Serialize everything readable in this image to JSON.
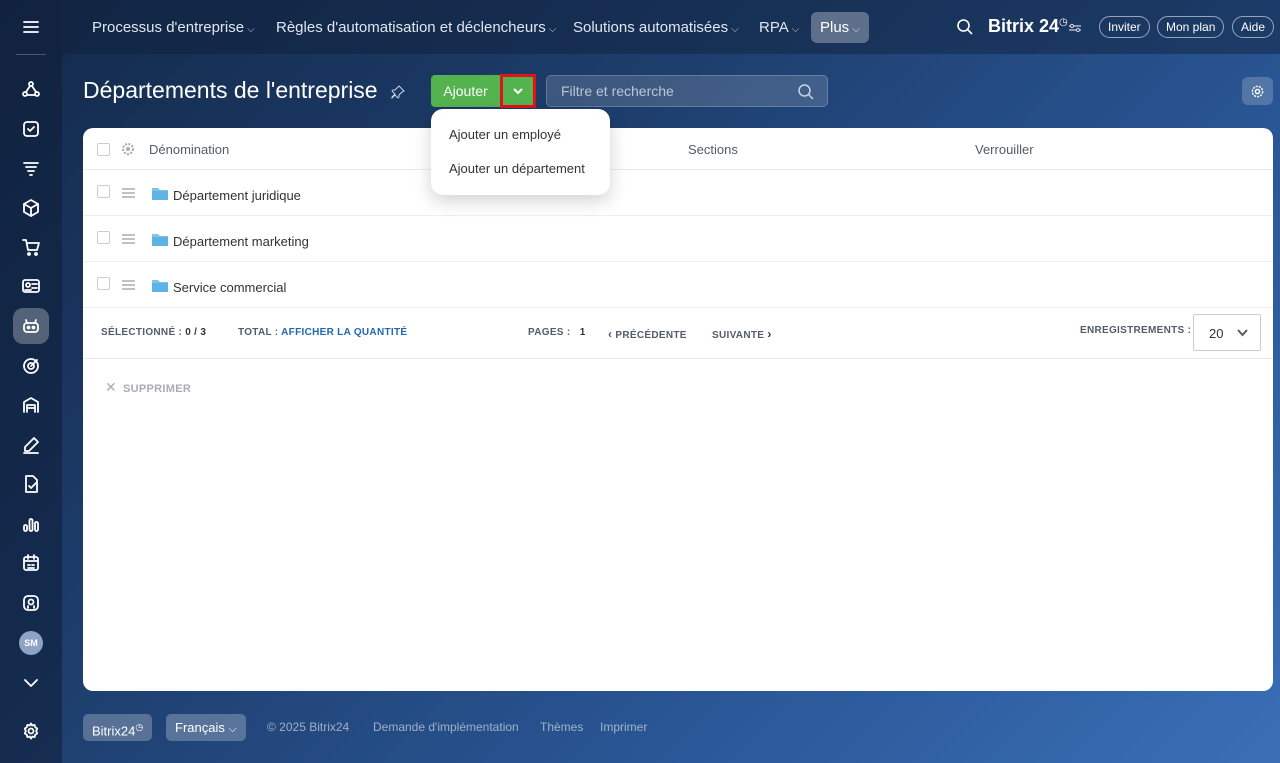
{
  "topnav": {
    "items": [
      {
        "label": "Processus d'entreprise"
      },
      {
        "label": "Règles d'automatisation et déclencheurs"
      },
      {
        "label": "Solutions automatisées"
      },
      {
        "label": "RPA"
      },
      {
        "label": "Plus"
      }
    ],
    "brand": "Bitrix 24",
    "invite_label": "Inviter",
    "plan_label": "Mon plan",
    "help_label": "Aide"
  },
  "sidebar": {
    "avatar_initials": "SM",
    "icons": [
      "menu-icon",
      "flow-icon",
      "checklist-icon",
      "filter-stack-icon",
      "box-icon",
      "cart-icon",
      "id-card-icon",
      "robot-icon",
      "target-icon",
      "warehouse-icon",
      "pen-icon",
      "sign-document-icon",
      "analytics-icon",
      "calendar-icon",
      "knowledge-icon",
      "chevron-down-icon",
      "settings-icon"
    ],
    "active": "robot-icon"
  },
  "page": {
    "title": "Départements de l'entreprise",
    "add_label": "Ajouter",
    "search_placeholder": "Filtre et recherche"
  },
  "dropdown": {
    "items": [
      {
        "label": "Ajouter un employé"
      },
      {
        "label": "Ajouter un département"
      }
    ]
  },
  "grid": {
    "columns": [
      "Dénomination",
      "Sections",
      "Verrouiller"
    ],
    "rows": [
      {
        "name": "Département juridique"
      },
      {
        "name": "Département marketing"
      },
      {
        "name": "Service commercial"
      }
    ],
    "selected_label": "SÉLECTIONNÉ :",
    "selected_value": "0 / 3",
    "total_label": "TOTAL :",
    "total_link": "AFFICHER LA QUANTITÉ",
    "pages_label": "PAGES :",
    "pages_value": "1",
    "prev_label": "PRÉCÉDENTE",
    "next_label": "SUIVANTE",
    "records_label": "ENREGISTREMENTS :",
    "records_value": "20",
    "delete_label": "SUPPRIMER"
  },
  "footer": {
    "brand_btn": "Bitrix24",
    "language": "Français",
    "copyright": "© 2025 Bitrix24",
    "links": [
      "Demande d'implémentation",
      "Thèmes",
      "Imprimer"
    ]
  }
}
